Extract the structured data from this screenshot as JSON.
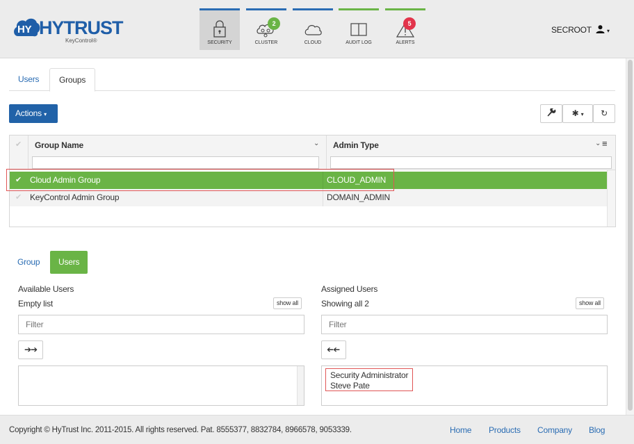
{
  "app": {
    "logo_text": "HYTRUST",
    "logo_sub": "KeyControl®"
  },
  "nav": [
    {
      "label": "SECURITY",
      "icon": "lock-icon",
      "bar_color": "#2a6cb3",
      "active": true
    },
    {
      "label": "CLUSTER",
      "icon": "cluster-icon",
      "bar_color": "#2a6cb3",
      "badge": "2",
      "badge_color": "#6ab446"
    },
    {
      "label": "CLOUD",
      "icon": "cloud-icon",
      "bar_color": "#2a6cb3"
    },
    {
      "label": "AUDIT LOG",
      "icon": "book-icon",
      "bar_color": "#6ab446"
    },
    {
      "label": "ALERTS",
      "icon": "warning-icon",
      "bar_color": "#6ab446",
      "badge": "5",
      "badge_color": "#e2344b"
    }
  ],
  "user": {
    "name": "SECROOT",
    "icon": "user-icon"
  },
  "tabs": [
    "Users",
    "Groups"
  ],
  "toolbar": {
    "actions_label": "Actions"
  },
  "grid": {
    "columns": [
      "Group Name",
      "Admin Type"
    ],
    "rows": [
      {
        "name": "Cloud Admin Group",
        "type": "CLOUD_ADMIN",
        "selected": true
      },
      {
        "name": "KeyControl Admin Group",
        "type": "DOMAIN_ADMIN",
        "selected": false
      }
    ]
  },
  "detail_tabs": [
    "Group",
    "Users"
  ],
  "available": {
    "title": "Available Users",
    "status": "Empty list",
    "show_all": "show all",
    "filter_placeholder": "Filter",
    "items": []
  },
  "assigned": {
    "title": "Assigned Users",
    "status": "Showing all 2",
    "show_all": "show all",
    "filter_placeholder": "Filter",
    "items": [
      "Security Administrator",
      "Steve Pate"
    ]
  },
  "footer": {
    "copyright": "Copyright © HyTrust Inc. 2011-2015. All rights reserved. Pat. 8555377, 8832784, 8966578, 9053339.",
    "links": [
      "Home",
      "Products",
      "Company",
      "Blog"
    ]
  },
  "colors": {
    "accent_blue": "#2162a8",
    "selected_green": "#6ab446",
    "highlight_red": "#e05555"
  }
}
